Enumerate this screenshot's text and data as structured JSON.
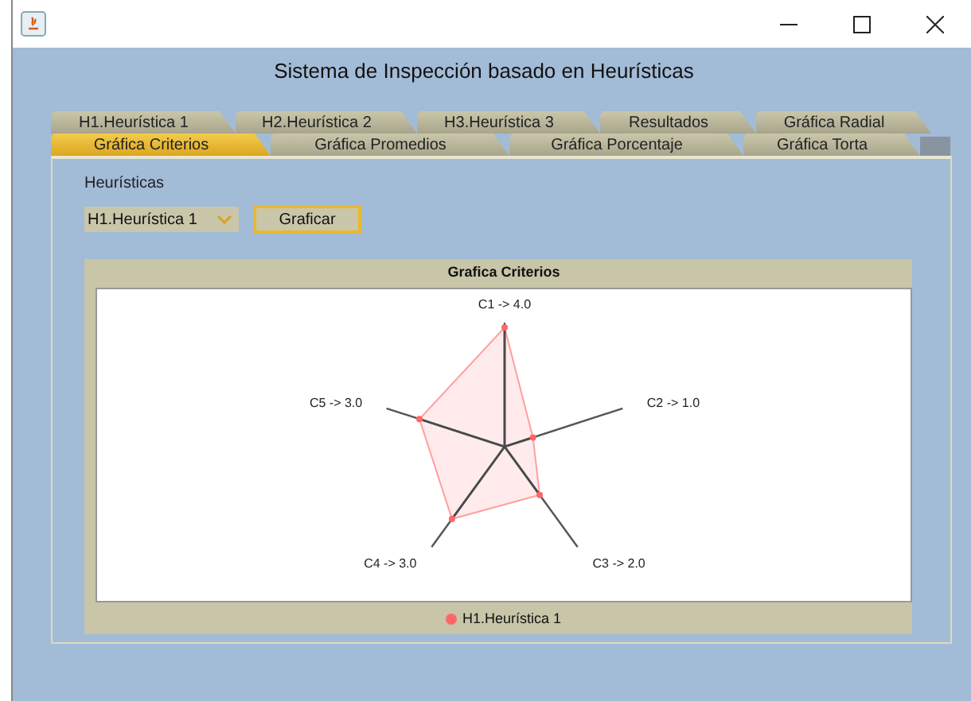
{
  "window": {
    "title": "Sistema de Inspección basado en Heurísticas"
  },
  "tab_rows": [
    [
      {
        "label": "H1.Heurística 1",
        "selected": false
      },
      {
        "label": "H2.Heurística 2",
        "selected": false
      },
      {
        "label": "H3.Heurística 3",
        "selected": false
      },
      {
        "label": "Resultados",
        "selected": false
      },
      {
        "label": "Gráfica Radial",
        "selected": false
      }
    ],
    [
      {
        "label": "Gráfica Criterios",
        "selected": true
      },
      {
        "label": "Gráfica Promedios",
        "selected": false
      },
      {
        "label": "Gráfica Porcentaje",
        "selected": false
      },
      {
        "label": "Gráfica Torta",
        "selected": false
      }
    ]
  ],
  "heuristics_label": "Heurísticas",
  "combo": {
    "value": "H1.Heurística 1"
  },
  "plot_button": "Graficar",
  "radar_chart": {
    "title": "Grafica Criterios",
    "axes": [
      {
        "label": "C1 -> 4.0",
        "level": 1.0
      },
      {
        "label": "C2 -> 1.0",
        "level": 0.25
      },
      {
        "label": "C3 -> 2.0",
        "level": 0.5
      },
      {
        "label": "C4 -> 3.0",
        "level": 0.75
      },
      {
        "label": "C5 -> 3.0",
        "level": 0.75
      }
    ],
    "legend": "H1.Heurística 1"
  }
}
